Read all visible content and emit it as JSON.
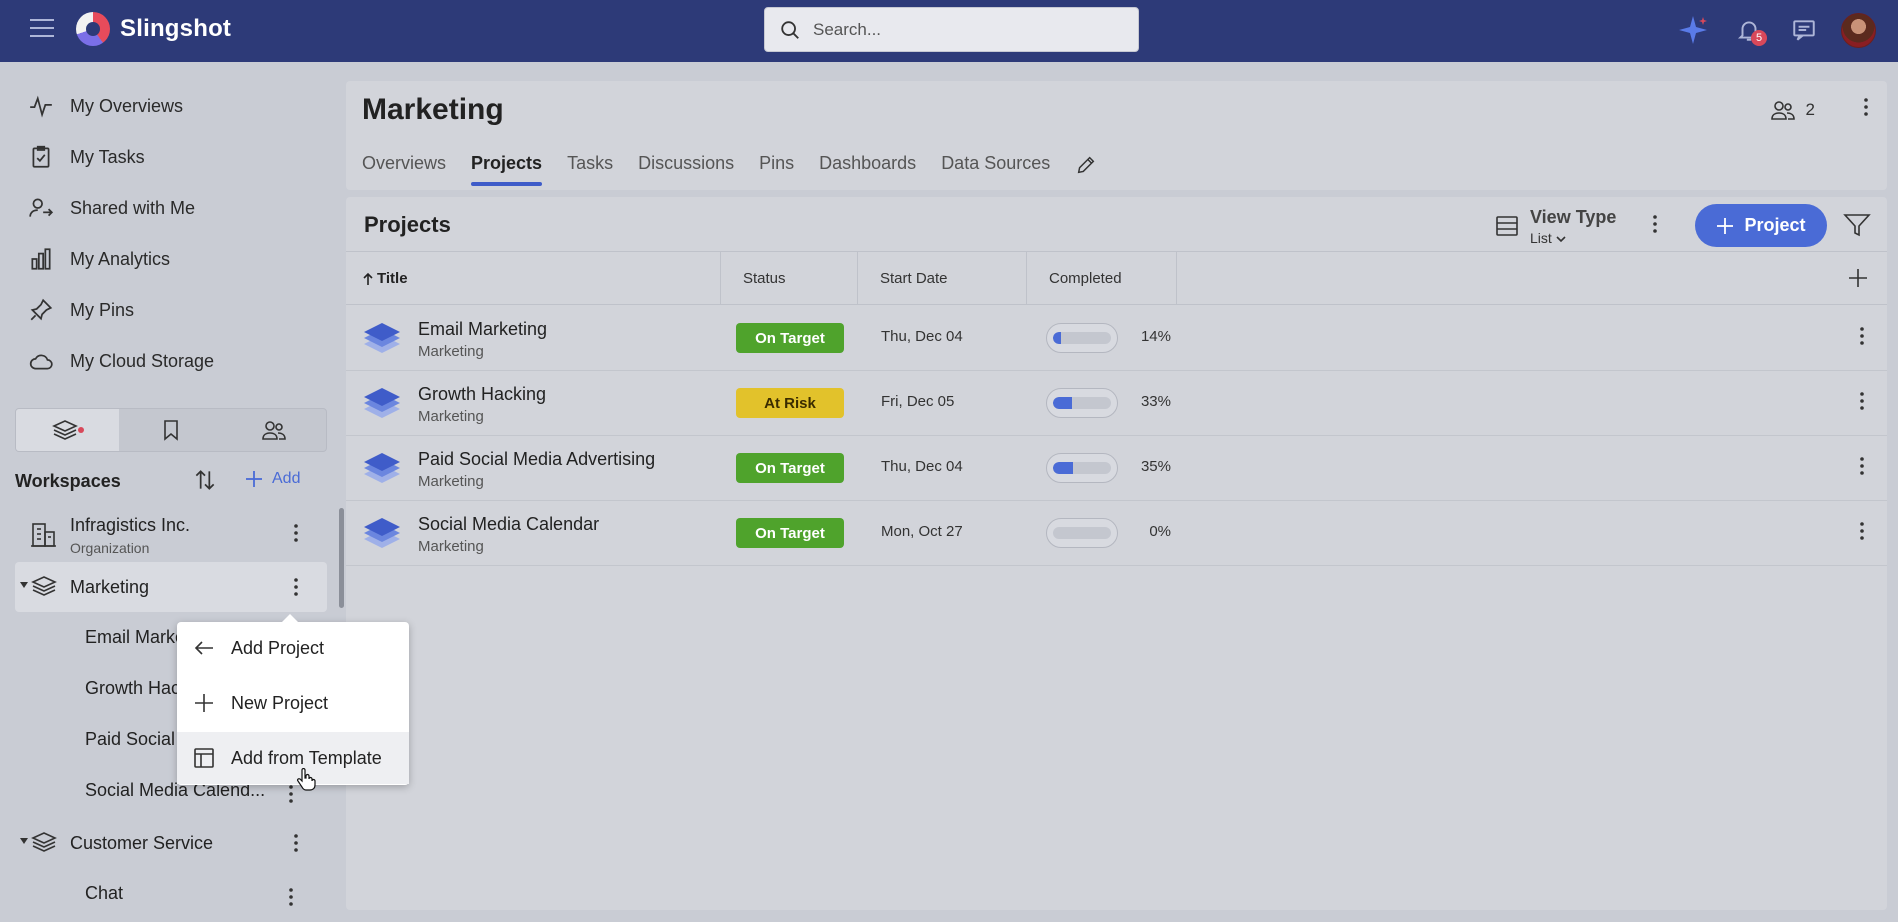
{
  "app": {
    "name": "Slingshot",
    "search_placeholder": "Search...",
    "notifications_count": "5"
  },
  "sidebar": {
    "nav": [
      {
        "label": "My Overviews",
        "icon": "pulse-icon"
      },
      {
        "label": "My Tasks",
        "icon": "clipboard-check-icon"
      },
      {
        "label": "Shared with Me",
        "icon": "user-share-icon"
      },
      {
        "label": "My Analytics",
        "icon": "bar-chart-icon"
      },
      {
        "label": "My Pins",
        "icon": "pin-icon"
      },
      {
        "label": "My Cloud Storage",
        "icon": "cloud-icon"
      }
    ],
    "workspaces_title": "Workspaces",
    "add_label": "Add",
    "workspaces": [
      {
        "name": "Infragistics Inc.",
        "sub": "Organization"
      },
      {
        "name": "Marketing"
      }
    ],
    "marketing_projects": [
      "Email Marke",
      "Growth Hac",
      "Paid Social",
      "Social Media Calend..."
    ],
    "other_workspaces": [
      {
        "name": "Customer Service"
      },
      {
        "name": "Chat"
      }
    ]
  },
  "context_menu": {
    "items": [
      "Add Project",
      "New Project",
      "Add from Template"
    ]
  },
  "header": {
    "title": "Marketing",
    "members_count": "2",
    "tabs": [
      "Overviews",
      "Projects",
      "Tasks",
      "Discussions",
      "Pins",
      "Dashboards",
      "Data Sources"
    ],
    "active_tab": "Projects"
  },
  "projects": {
    "title": "Projects",
    "view_type_label": "View Type",
    "view_type_value": "List",
    "add_button": "Project",
    "columns": [
      "Title",
      "Status",
      "Start Date",
      "Completed"
    ],
    "rows": [
      {
        "name": "Email Marketing",
        "workspace": "Marketing",
        "status": "On Target",
        "start": "Thu, Dec 04",
        "completed": 14,
        "completed_label": "14%"
      },
      {
        "name": "Growth Hacking",
        "workspace": "Marketing",
        "status": "At Risk",
        "start": "Fri, Dec 05",
        "completed": 33,
        "completed_label": "33%"
      },
      {
        "name": "Paid Social Media Advertising",
        "workspace": "Marketing",
        "status": "On Target",
        "start": "Thu, Dec 04",
        "completed": 35,
        "completed_label": "35%"
      },
      {
        "name": "Social Media Calendar",
        "workspace": "Marketing",
        "status": "On Target",
        "start": "Mon, Oct 27",
        "completed": 0,
        "completed_label": "0%"
      }
    ]
  },
  "colors": {
    "topbar": "#2d3a78",
    "accent": "#4a6bd6",
    "on_target": "#4fa32c",
    "at_risk": "#e2c22b"
  }
}
